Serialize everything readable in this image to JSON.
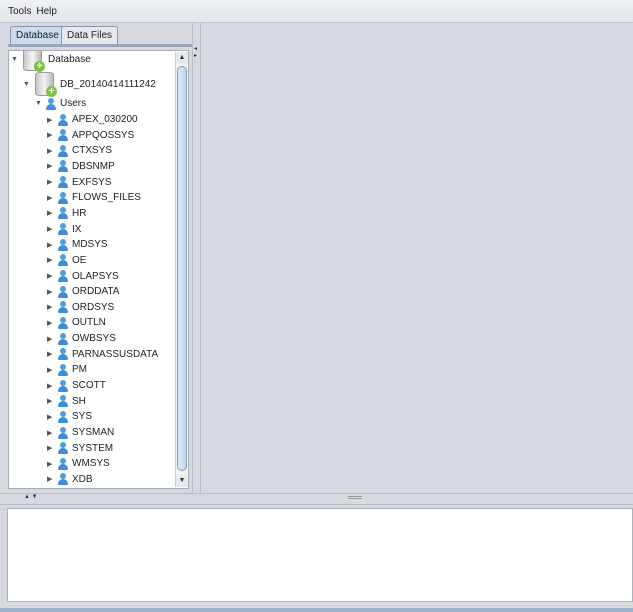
{
  "menu": [
    "Tools",
    "Help"
  ],
  "tabs": [
    {
      "label": "Database",
      "active": true
    },
    {
      "label": "Data Files",
      "active": false
    }
  ],
  "tree": {
    "root": "Database",
    "db": "DB_20140414111242",
    "users_label": "Users",
    "users": [
      "APEX_030200",
      "APPQOSSYS",
      "CTXSYS",
      "DBSNMP",
      "EXFSYS",
      "FLOWS_FILES",
      "HR",
      "IX",
      "MDSYS",
      "OE",
      "OLAPSYS",
      "ORDDATA",
      "ORDSYS",
      "OUTLN",
      "OWBSYS",
      "PARNASSUSDATA",
      "PM",
      "SCOTT",
      "SH",
      "SYS",
      "SYSMAN",
      "SYSTEM",
      "WMSYS",
      "XDB"
    ]
  }
}
